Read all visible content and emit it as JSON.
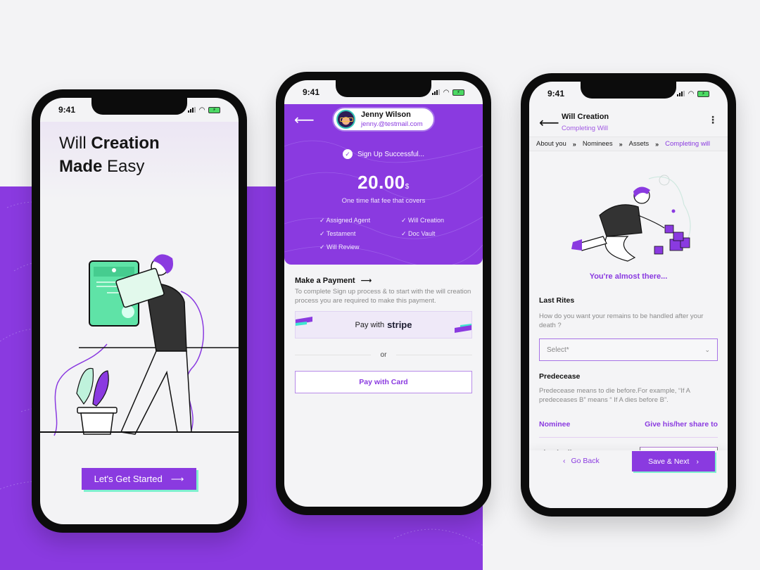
{
  "colors": {
    "brand": "#8a3ae0",
    "accent": "#7ff0cf",
    "background": "#f3f3f5"
  },
  "status_bar": {
    "time": "9:41"
  },
  "welcome_screen": {
    "title_line1_light": "Will",
    "title_line1_bold": "Creation",
    "title_line2_bold": "Made",
    "title_line2_light": "Easy",
    "cta_label": "Let's Get Started",
    "cta_icon": "arrow-right-icon"
  },
  "payment_screen": {
    "profile": {
      "name": "Jenny Wilson",
      "email": "jenny.@testmail.com"
    },
    "signup_status": "Sign Up Successful...",
    "price": "20.00",
    "currency": "$",
    "price_subtitle": "One time flat fee that covers",
    "features": [
      "Assigned Agent",
      "Will Creation",
      "Testament",
      "Doc Vault",
      "Will Review"
    ],
    "make_payment_title": "Make a Payment",
    "make_payment_desc": "To complete Sign up process & to start with the will creation process you are required to make this payment.",
    "stripe_prefix": "Pay with",
    "stripe_brand": "stripe",
    "or_label": "or",
    "card_button": "Pay with Card"
  },
  "will_screen": {
    "header_title": "Will Creation",
    "header_subtitle": "Completing Will",
    "breadcrumbs": [
      "About you",
      "Nominees",
      "Assets",
      "Completing will"
    ],
    "breadcrumb_sep": "»",
    "almost_there": "You're almost there...",
    "last_rites_title": "Last Rites",
    "last_rites_desc": "How do you want your remains to be handled after your death ?",
    "select_placeholder": "Select*",
    "predecease_title": "Predecease",
    "predecease_desc": "Predecease means to die before.For example, “If A predeceases B” means “ If A dies before B”.",
    "nominee_header": "Nominee",
    "share_header": "Give his/her share to",
    "nominee_name": "Floyd Wilson",
    "go_back": "Go Back",
    "save_next": "Save & Next"
  }
}
